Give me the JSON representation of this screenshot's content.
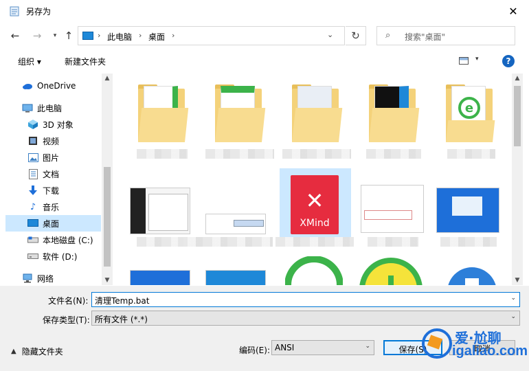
{
  "window": {
    "title": "另存为"
  },
  "address": {
    "crumbs": [
      "此电脑",
      "桌面"
    ],
    "search_placeholder": "搜索\"桌面\""
  },
  "toolbar": {
    "organize": "组织 ▾",
    "new_folder": "新建文件夹",
    "help": "?"
  },
  "nav": {
    "items": [
      {
        "label": "OneDrive",
        "icon": "cloud-icon"
      },
      {
        "label": "此电脑",
        "icon": "computer-icon"
      },
      {
        "label": "3D 对象",
        "icon": "cube-icon"
      },
      {
        "label": "视频",
        "icon": "video-icon"
      },
      {
        "label": "图片",
        "icon": "pictures-icon"
      },
      {
        "label": "文档",
        "icon": "document-icon"
      },
      {
        "label": "下载",
        "icon": "download-icon"
      },
      {
        "label": "音乐",
        "icon": "music-icon"
      },
      {
        "label": "桌面",
        "icon": "desktop-icon",
        "selected": true
      },
      {
        "label": "本地磁盘 (C:)",
        "icon": "drive-icon"
      },
      {
        "label": "软件 (D:)",
        "icon": "drive-icon"
      },
      {
        "label": "网络",
        "icon": "network-icon"
      }
    ]
  },
  "files": {
    "xmind_label": "XMind"
  },
  "form": {
    "filename_label": "文件名(N):",
    "filename_value": "清理Temp.bat",
    "filetype_label": "保存类型(T):",
    "filetype_value": "所有文件 (*.*)",
    "encoding_label": "编码(E):",
    "encoding_value": "ANSI",
    "hide_folders": "隐藏文件夹",
    "save": "保存(S)",
    "cancel": "取消"
  },
  "watermark": {
    "top": "爱·尬聊",
    "bottom": "igaliao.com"
  },
  "colors": {
    "accent": "#0078d7",
    "selected": "#cce8ff",
    "folder": "#f4d27a",
    "xmind": "#e62c3f"
  }
}
